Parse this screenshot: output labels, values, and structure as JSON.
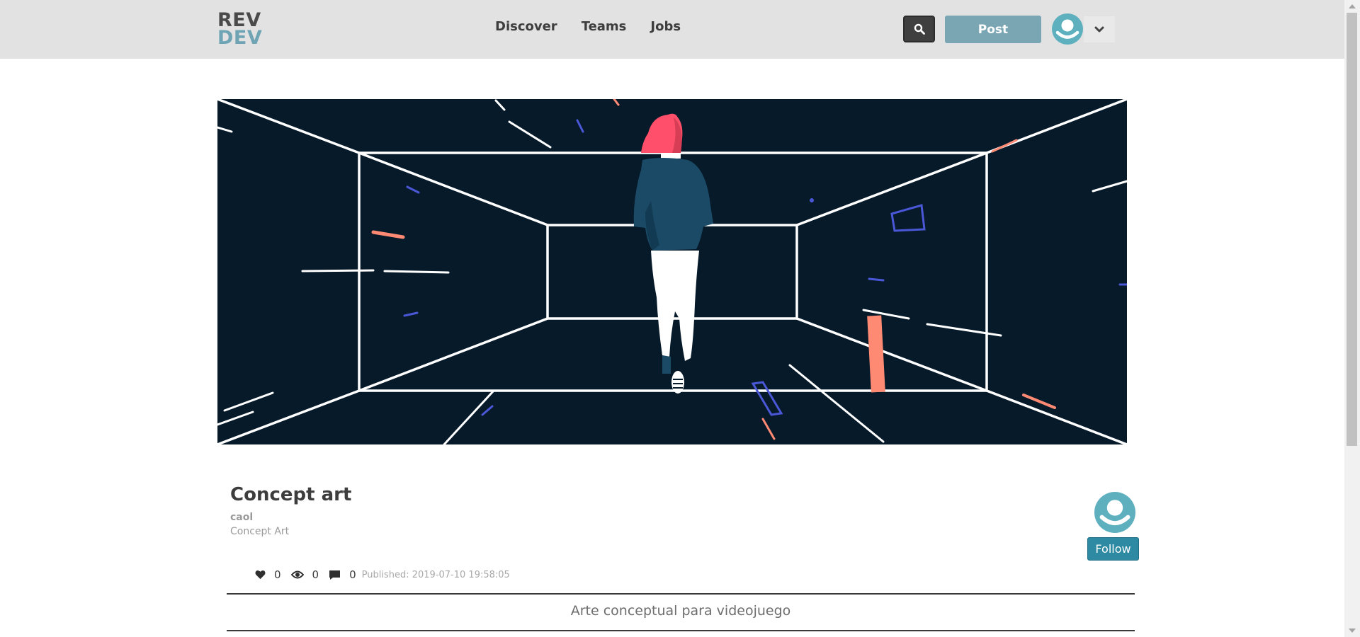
{
  "header": {
    "logo_line1": "REV",
    "logo_line2": "DEV",
    "nav": [
      "Discover",
      "Teams",
      "Jobs"
    ],
    "post_label": "Post"
  },
  "post": {
    "title": "Concept art",
    "author": "caol",
    "category": "Concept Art",
    "follow_label": "Follow",
    "likes": "0",
    "views": "0",
    "comments": "0",
    "published": "Published: 2019-07-10 19:58:05",
    "description": "Arte conceptual para videojuego"
  },
  "colors": {
    "header_bg": "#e2e2e2",
    "brand_dark": "#4a4a4a",
    "brand_accent": "#6ea4b3",
    "post_button": "#7aa6b3",
    "follow_button": "#2e8aa3",
    "avatar": "#5fb0bf",
    "hero_bg": "#061a2a"
  },
  "icons": {
    "search": "search-icon",
    "avatar": "user-avatar-icon",
    "dropdown": "chevron-down-icon",
    "likes": "heart-icon",
    "views": "eye-icon",
    "comments": "comment-icon"
  }
}
